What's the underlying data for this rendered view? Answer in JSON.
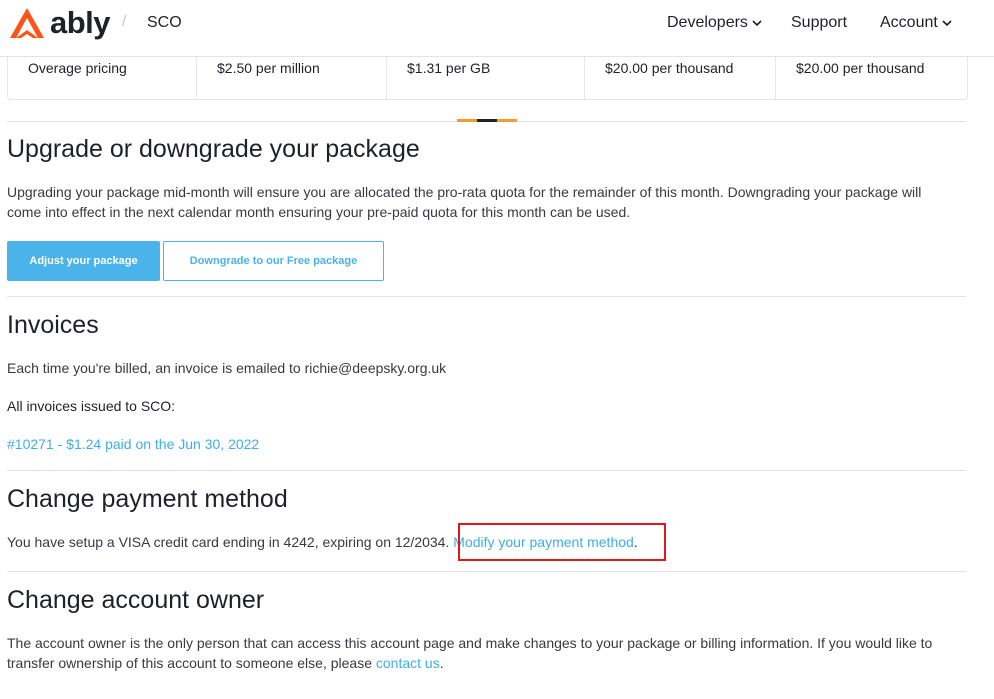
{
  "header": {
    "brand": "ably",
    "breadcrumb_separator": "/",
    "app_name": "SCO",
    "nav": [
      {
        "label": "Developers",
        "has_dropdown": true
      },
      {
        "label": "Support",
        "has_dropdown": false
      },
      {
        "label": "Account",
        "has_dropdown": true
      }
    ],
    "chevron_glyph": "⌄"
  },
  "pricing": {
    "row_label": "Overage pricing",
    "cells": [
      "$2.50 per million",
      "$1.31 per GB",
      "$20.00 per thousand",
      "$20.00 per thousand"
    ]
  },
  "colors": {
    "accent": "#49b3ea",
    "link": "#3faee6",
    "brand_orange": "#ff5416",
    "highlight": "#e0161b",
    "tick_orange": "#f39c34",
    "tick_dark": "#1f2129"
  },
  "upgrade": {
    "title": "Upgrade or downgrade your package",
    "description": "Upgrading your package mid-month will ensure you are allocated the pro-rata quota for the remainder of this month. Downgrading your package will come into effect in the next calendar month ensuring your pre-paid quota for this month can be used.",
    "adjust_button": "Adjust your package",
    "downgrade_button": "Downgrade to our Free package"
  },
  "invoices": {
    "title": "Invoices",
    "email_text": "Each time you're billed, an invoice is emailed to richie@deepsky.org.uk",
    "issued_to_text": "All invoices issued to SCO:",
    "items": [
      "#10271 - $1.24 paid on the Jun 30, 2022"
    ]
  },
  "payment": {
    "title": "Change payment method",
    "text": "You have setup a VISA credit card ending in 4242, expiring on 12/2034.",
    "modify_link": "Modify your payment method",
    "trailing": "."
  },
  "owner": {
    "title": "Change account owner",
    "text": "The account owner is the only person that can access this account page and make changes to your package or billing information. If you would like to transfer ownership of this account to someone else, please",
    "contact_link": "contact us",
    "trailing": "."
  }
}
